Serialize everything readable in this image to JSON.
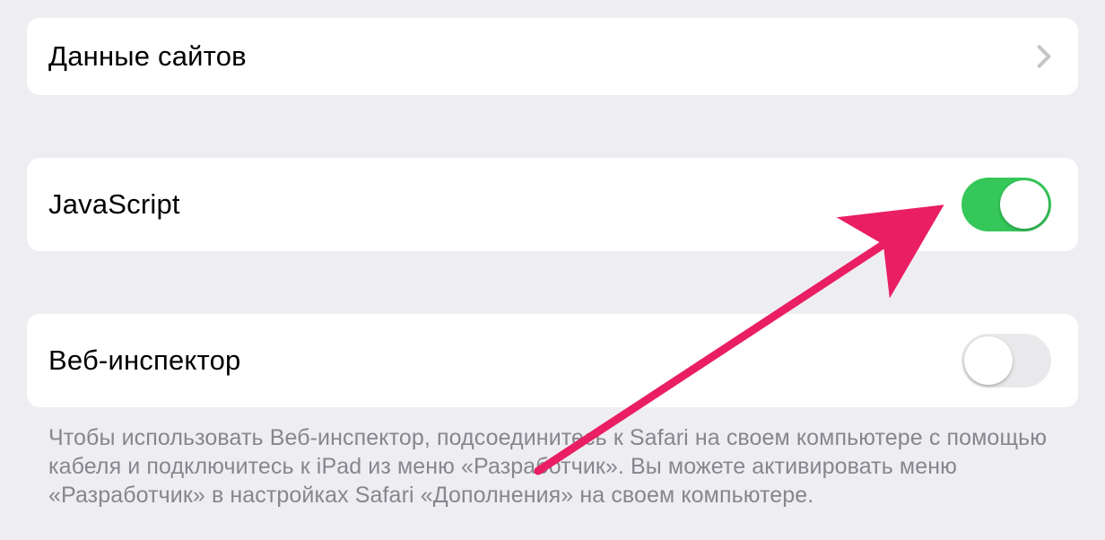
{
  "rows": {
    "siteData": {
      "label": "Данные сайтов",
      "type": "navigation"
    },
    "javascript": {
      "label": "JavaScript",
      "type": "toggle",
      "enabled": true
    },
    "webInspector": {
      "label": "Веб-инспектор",
      "type": "toggle",
      "enabled": false
    }
  },
  "footer": {
    "text": "Чтобы использовать Веб-инспектор, подсоединитесь к Safari на своем компьютере с помощью кабеля и подключитесь к iPad из меню «Разработчик». Вы можете активировать меню «Разработчик» в настройках Safari «Дополнения» на своем компьютере."
  },
  "annotation": {
    "arrowColor": "#e91e63"
  }
}
